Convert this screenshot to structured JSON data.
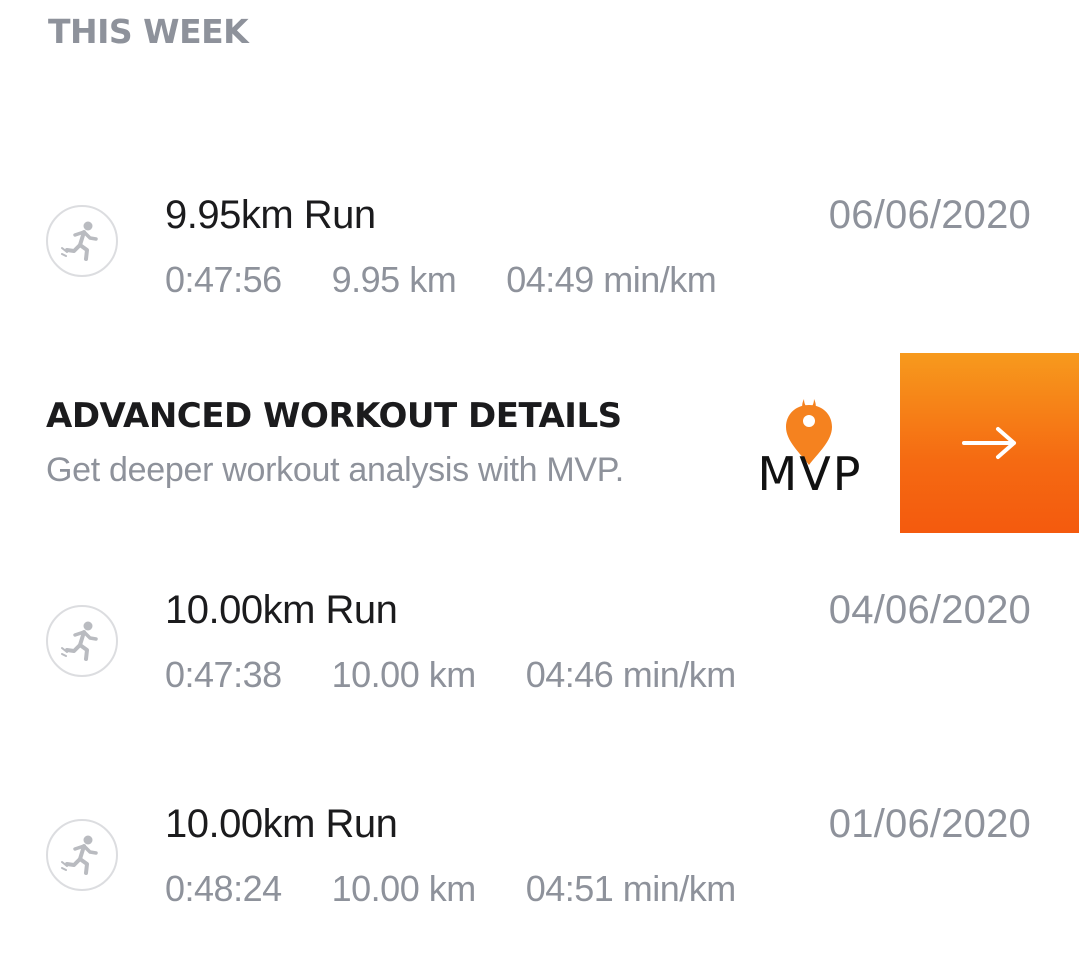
{
  "section": {
    "title": "THIS WEEK"
  },
  "workouts": [
    {
      "title": "9.95km Run",
      "date": "06/06/2020",
      "duration": "0:47:56",
      "distance": "9.95 km",
      "pace": "04:49 min/km",
      "icon": "running-person-icon"
    },
    {
      "title": "10.00km Run",
      "date": "04/06/2020",
      "duration": "0:47:38",
      "distance": "10.00 km",
      "pace": "04:46 min/km",
      "icon": "running-person-icon"
    },
    {
      "title": "10.00km Run",
      "date": "01/06/2020",
      "duration": "0:48:24",
      "distance": "10.00 km",
      "pace": "04:51 min/km",
      "icon": "running-person-icon"
    }
  ],
  "promo": {
    "heading": "ADVANCED WORKOUT DETAILS",
    "subtext": "Get deeper workout analysis with MVP.",
    "logo_text": "MVP",
    "logo_icon": "flame-pin-icon",
    "button_icon": "arrow-right-icon",
    "accent_color": "#f5701a"
  },
  "colors": {
    "title_text": "#1b1b1d",
    "secondary_text": "#8e929b",
    "icon_ring": "#dcdde0",
    "icon_figure": "#b9bbc0"
  }
}
